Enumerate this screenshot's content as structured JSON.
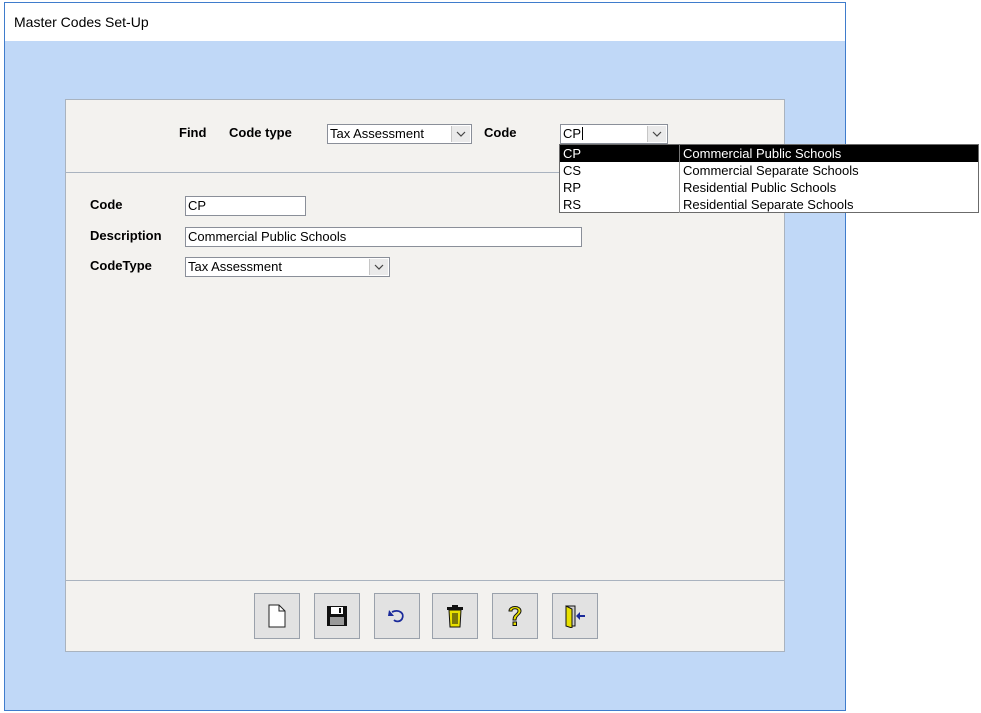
{
  "window": {
    "title": "Master Codes Set-Up"
  },
  "find_bar": {
    "find_label": "Find",
    "code_type_label": "Code type",
    "code_type_value": "Tax Assessment",
    "code_label": "Code",
    "code_value": "CP"
  },
  "code_dropdown": {
    "items": [
      {
        "code": "CP",
        "description": "Commercial Public Schools",
        "selected": true
      },
      {
        "code": "CS",
        "description": "Commercial Separate Schools",
        "selected": false
      },
      {
        "code": "RP",
        "description": "Residential Public Schools",
        "selected": false
      },
      {
        "code": "RS",
        "description": "Residential Separate Schools",
        "selected": false
      }
    ]
  },
  "form": {
    "code_label": "Code",
    "code_value": "CP",
    "description_label": "Description",
    "description_value": "Commercial Public Schools",
    "codetype_label": "CodeType",
    "codetype_value": "Tax Assessment"
  },
  "toolbar": {
    "buttons": [
      {
        "icon": "new-document-icon"
      },
      {
        "icon": "save-disk-icon"
      },
      {
        "icon": "undo-icon"
      },
      {
        "icon": "trash-icon"
      },
      {
        "icon": "help-question-icon"
      },
      {
        "icon": "exit-door-icon"
      }
    ],
    "colors": {
      "icon_yellow": "#e8e000",
      "icon_blue": "#1a2a9a"
    }
  }
}
